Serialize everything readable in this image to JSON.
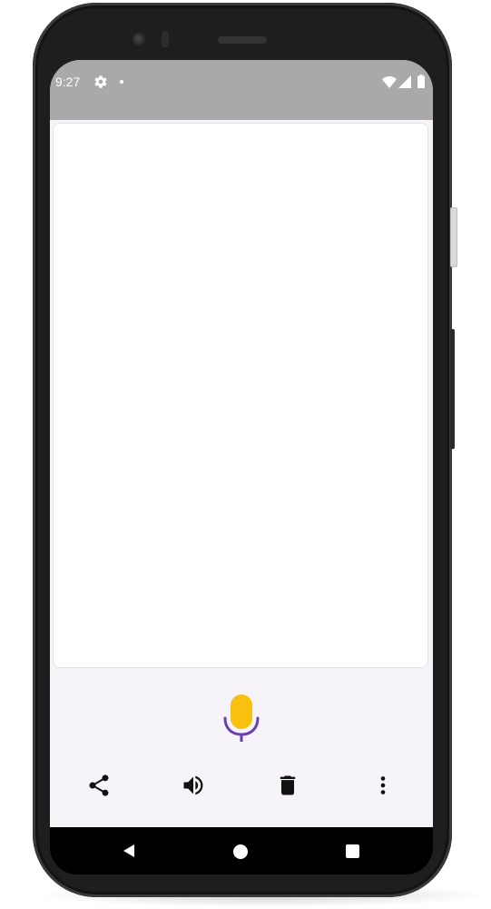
{
  "status_bar": {
    "time": "9:27",
    "icons": [
      "gear-icon",
      "notification-dot-icon",
      "wifi-icon",
      "cell-signal-icon",
      "battery-icon"
    ]
  },
  "transcript": {
    "text": ""
  },
  "mic": {
    "icon": "microphone-icon",
    "capsule_color": "#f9c10f",
    "stand_color": "#6b3fb0"
  },
  "toolbar": {
    "items": [
      "share-icon",
      "volume-icon",
      "delete-icon",
      "more-vert-icon"
    ]
  },
  "nav_bar": {
    "items": [
      "back-icon",
      "home-icon",
      "recents-icon"
    ]
  },
  "colors": {
    "status_bar_bg": "#aaa8ab",
    "app_bg": "#f6f4f8",
    "icon_color": "#111111"
  }
}
